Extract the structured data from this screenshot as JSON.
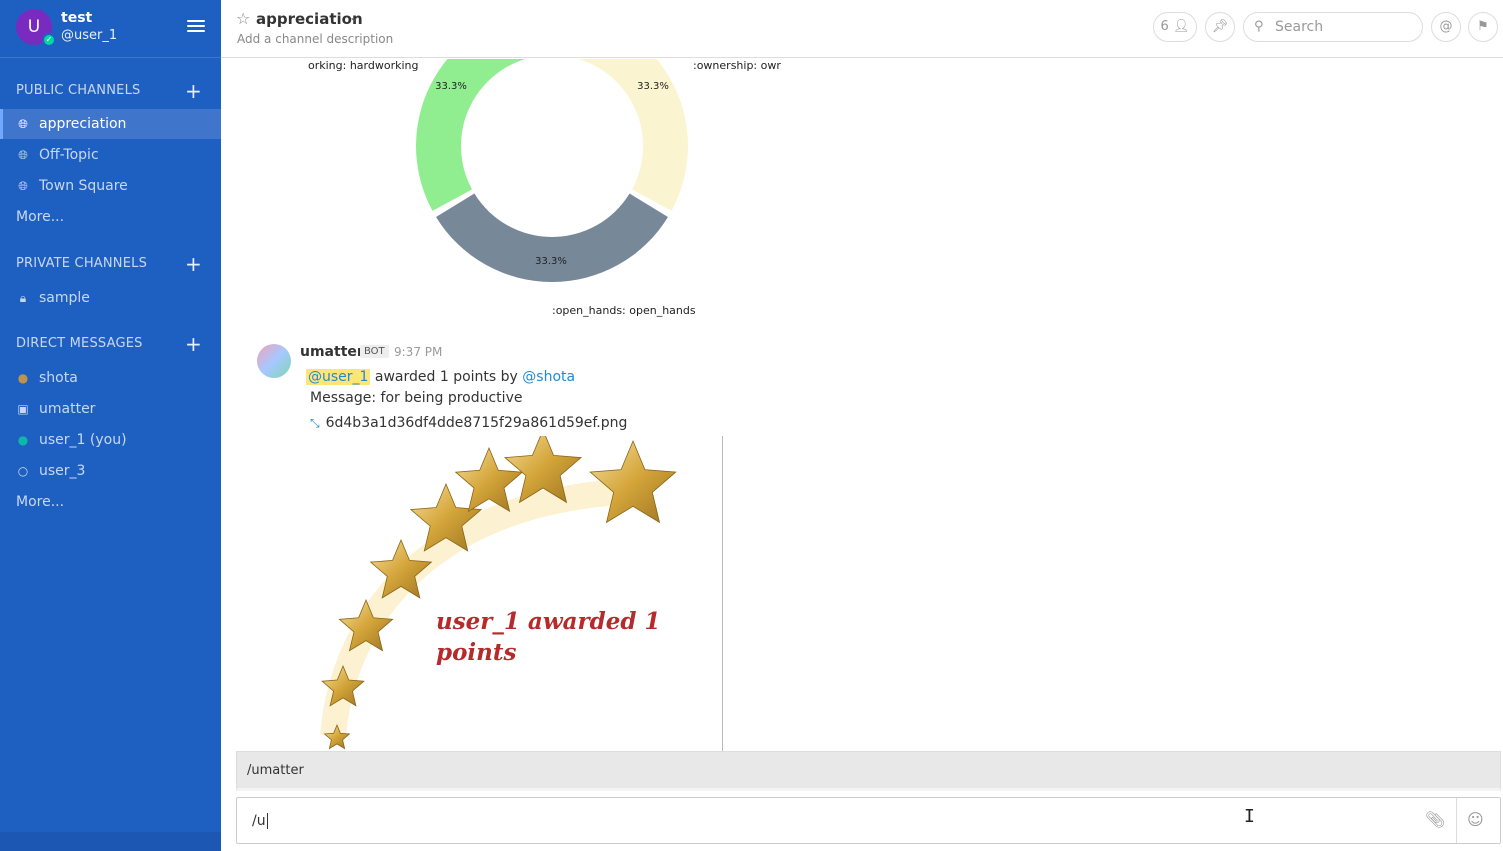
{
  "sidebar": {
    "team_name": "test",
    "avatar_letter": "U",
    "user_handle": "@user_1",
    "public_title": "PUBLIC CHANNELS",
    "public_channels": [
      {
        "label": "appreciation",
        "icon": "globe-icon",
        "active": true
      },
      {
        "label": "Off-Topic",
        "icon": "globe-icon"
      },
      {
        "label": "Town Square",
        "icon": "globe-icon"
      }
    ],
    "public_more": "More...",
    "private_title": "PRIVATE CHANNELS",
    "private_channels": [
      {
        "label": "sample",
        "icon": "lock-icon"
      }
    ],
    "dm_title": "DIRECT MESSAGES",
    "direct_messages": [
      {
        "label": "shota",
        "icon": "user-icon"
      },
      {
        "label": "umatter",
        "icon": "bot-icon"
      },
      {
        "label": "user_1 (you)",
        "icon": "user-icon"
      },
      {
        "label": "user_3",
        "icon": "user-icon"
      }
    ],
    "dm_more": "More..."
  },
  "header": {
    "channel_name": "appreciation",
    "description": "Add a channel description",
    "member_count": "6",
    "search_placeholder": "Search"
  },
  "chart_data": {
    "type": "pie",
    "donut": true,
    "values": [
      33.3,
      33.3,
      33.3
    ],
    "value_labels": [
      "33.3%",
      "33.3%",
      "33.3%"
    ],
    "labels": [
      "orking: hardworking",
      ":ownership: owr",
      ":open_hands: open_hands"
    ],
    "colors": [
      "#90ee90",
      "#faf5d0",
      "#778899"
    ]
  },
  "post": {
    "username": "umatter",
    "bot_tag": "BOT",
    "time": "9:37 PM",
    "mention": "@user_1",
    "award_text": " awarded 1 points by ",
    "by_mention": "@shota",
    "message_label": "Message",
    "message_text": ": for being productive",
    "file_name": "6d4b3a1d36df4dde8715f29a861d59ef.png",
    "image_text_line1": "user_1 awarded 1",
    "image_text_line2": "points"
  },
  "autocomplete": {
    "suggestion": "/umatter"
  },
  "composer": {
    "value": "/u"
  }
}
